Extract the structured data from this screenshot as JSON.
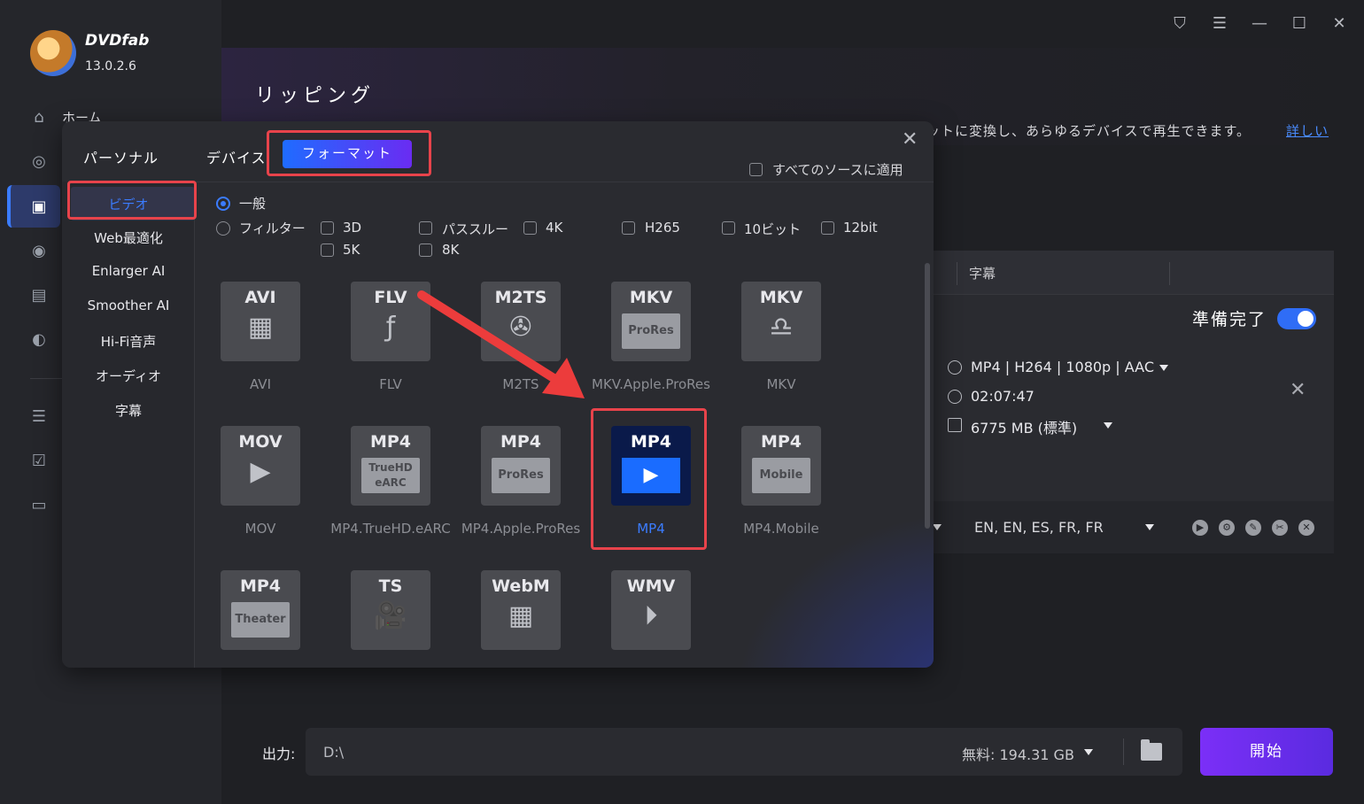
{
  "app": {
    "brand": "DVDfab",
    "version": "13.0.2.6",
    "home_label": "ホーム"
  },
  "header": {
    "title": "リッピング",
    "description": "ットに変換し、あらゆるデバイスで再生できます。",
    "more_link": "詳しい"
  },
  "task": {
    "col_subtitle": "字幕",
    "ready_label": "準備完了",
    "ready_toggle": true,
    "profile": "MP4 | H264 | 1080p | AAC",
    "duration": "02:07:47",
    "size": "6775 MB (標準)",
    "audio": "EN, EN, ES, FR, FR"
  },
  "output": {
    "label": "出力:",
    "path": "D:\\",
    "free": "無料:  194.31 GB",
    "start_label": "開始"
  },
  "modal": {
    "tabs": {
      "personal": "パーソナル",
      "device": "デバイス",
      "format": "フォーマット"
    },
    "apply_all": "すべてのソースに適用",
    "categories": [
      "ビデオ",
      "Web最適化",
      "Enlarger AI",
      "Smoother AI",
      "Hi-Fi音声",
      "オーディオ",
      "字幕"
    ],
    "active_category": "ビデオ",
    "mode_general": "一般",
    "mode_filter": "フィルター",
    "filters": [
      "3D",
      "パススルー",
      "4K",
      "H265",
      "10ビット",
      "12bit",
      "5K",
      "8K"
    ],
    "formats": [
      {
        "code": "AVI",
        "label": "AVI",
        "glyph": "film"
      },
      {
        "code": "FLV",
        "label": "FLV",
        "glyph": "flash"
      },
      {
        "code": "M2TS",
        "label": "M2TS",
        "glyph": "reel"
      },
      {
        "code": "MKV",
        "label": "MKV.Apple.ProRes",
        "sub": "ProRes"
      },
      {
        "code": "MKV",
        "label": "MKV",
        "glyph": "mkv"
      },
      {
        "code": "MOV",
        "label": "MOV",
        "glyph": "play"
      },
      {
        "code": "MP4",
        "label": "MP4.TrueHD.eARC",
        "sub": "TrueHD eARC"
      },
      {
        "code": "MP4",
        "label": "MP4.Apple.ProRes",
        "sub": "ProRes"
      },
      {
        "code": "MP4",
        "label": "MP4",
        "glyph": "play",
        "selected": true
      },
      {
        "code": "MP4",
        "label": "MP4.Mobile",
        "sub": "Mobile"
      },
      {
        "code": "MP4",
        "label": "",
        "sub": "Theater"
      },
      {
        "code": "TS",
        "label": "",
        "glyph": "camera"
      },
      {
        "code": "WebM",
        "label": "",
        "glyph": "film"
      },
      {
        "code": "WMV",
        "label": "",
        "glyph": "circle-play"
      }
    ]
  },
  "colors": {
    "accent_blue": "#3b7cff",
    "highlight_red": "#e8434b",
    "start_purple": "#7b2ff7"
  }
}
